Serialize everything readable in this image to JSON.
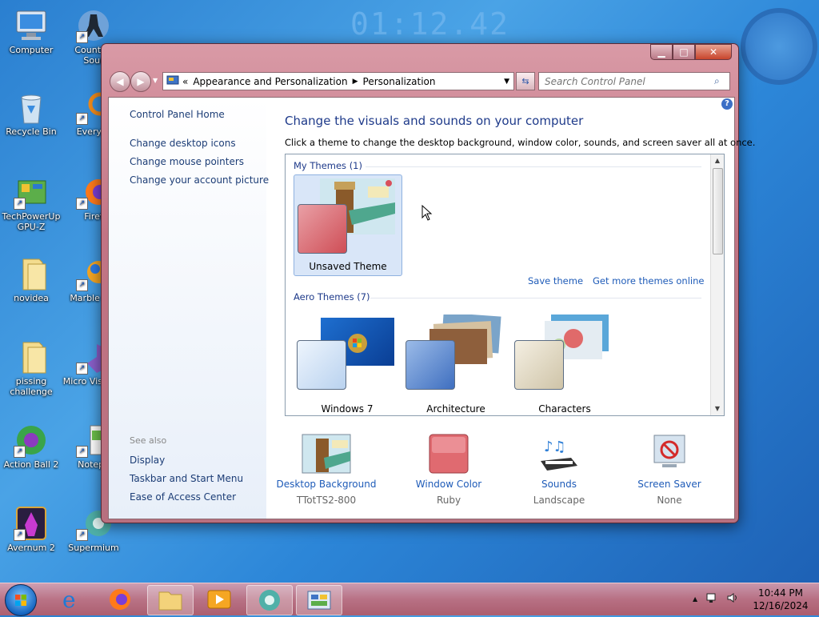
{
  "wallpaper": {
    "clock": "01:12.42"
  },
  "desktop_icons": [
    {
      "label": "Computer",
      "icon": "computer-icon"
    },
    {
      "label": "Counter-\nSour",
      "icon": "counter-strike-icon"
    },
    {
      "label": "Recycle Bin",
      "icon": "recycle-bin-icon"
    },
    {
      "label": "Everyth",
      "icon": "everything-icon"
    },
    {
      "label": "TechPowerUp GPU-Z",
      "icon": "gpu-z-icon"
    },
    {
      "label": "Firef",
      "icon": "firefox-icon"
    },
    {
      "label": "novidea",
      "icon": "folder-icon"
    },
    {
      "label": "Marble Gol",
      "icon": "marble-golf-icon"
    },
    {
      "label": "pissing challenge",
      "icon": "folder-icon"
    },
    {
      "label": "Micro Visual S",
      "icon": "visual-studio-icon"
    },
    {
      "label": "Action Ball 2",
      "icon": "action-ball-icon"
    },
    {
      "label": "Notepa",
      "icon": "notepad-icon"
    },
    {
      "label": "Avernum 2",
      "icon": "avernum-icon"
    },
    {
      "label": "Supermium",
      "icon": "supermium-icon"
    }
  ],
  "window": {
    "address": {
      "root_chevron": "«",
      "crumb1": "Appearance and Personalization",
      "crumb2": "Personalization"
    },
    "search_placeholder": "Search Control Panel",
    "sidebar": {
      "home": "Control Panel Home",
      "links": [
        "Change desktop icons",
        "Change mouse pointers",
        "Change your account picture"
      ],
      "see_also_title": "See also",
      "see_also": [
        "Display",
        "Taskbar and Start Menu",
        "Ease of Access Center"
      ]
    },
    "main": {
      "heading": "Change the visuals and sounds on your computer",
      "subheading": "Click a theme to change the desktop background, window color, sounds, and screen saver all at once.",
      "my_themes_title": "My Themes (1)",
      "my_themes": [
        {
          "label": "Unsaved Theme",
          "color": "#d9585f"
        }
      ],
      "save_theme": "Save theme",
      "get_more": "Get more themes online",
      "aero_title": "Aero Themes (7)",
      "aero_themes": [
        {
          "label": "Windows 7",
          "color": "#c9daf0"
        },
        {
          "label": "Architecture",
          "color": "#6f95cf"
        },
        {
          "label": "Characters",
          "color": "#d8cdb4"
        }
      ],
      "bottom": [
        {
          "label": "Desktop Background",
          "value": "TTotTS2-800",
          "icon": "desktop-background-icon"
        },
        {
          "label": "Window Color",
          "value": "Ruby",
          "icon": "window-color-icon"
        },
        {
          "label": "Sounds",
          "value": "Landscape",
          "icon": "sounds-icon"
        },
        {
          "label": "Screen Saver",
          "value": "None",
          "icon": "screen-saver-icon"
        }
      ]
    }
  },
  "taskbar": {
    "clock_time": "10:44 PM",
    "clock_date": "12/16/2024",
    "tray_arrow": "▲"
  }
}
